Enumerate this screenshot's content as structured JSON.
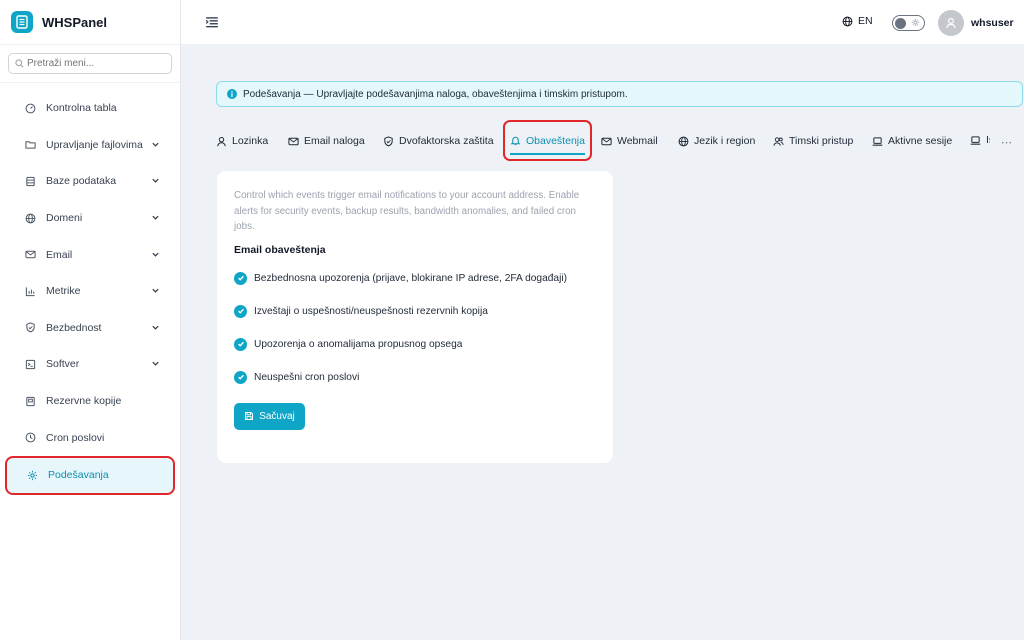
{
  "app": {
    "name": "WHSPanel"
  },
  "search": {
    "placeholder": "Pretraži meni..."
  },
  "sidebar": {
    "items": [
      {
        "label": "Kontrolna tabla",
        "icon": "gauge-icon",
        "expandable": false
      },
      {
        "label": "Upravljanje fajlovima",
        "icon": "folder-icon",
        "expandable": true
      },
      {
        "label": "Baze podataka",
        "icon": "database-icon",
        "expandable": true
      },
      {
        "label": "Domeni",
        "icon": "globe-icon",
        "expandable": true
      },
      {
        "label": "Email",
        "icon": "mail-icon",
        "expandable": true
      },
      {
        "label": "Metrike",
        "icon": "chart-icon",
        "expandable": true
      },
      {
        "label": "Bezbednost",
        "icon": "shield-icon",
        "expandable": true
      },
      {
        "label": "Softver",
        "icon": "terminal-icon",
        "expandable": true
      },
      {
        "label": "Rezervne kopije",
        "icon": "archive-icon",
        "expandable": false
      },
      {
        "label": "Cron poslovi",
        "icon": "clock-icon",
        "expandable": false
      },
      {
        "label": "Podešavanja",
        "icon": "gear-icon",
        "expandable": false,
        "active": true
      }
    ]
  },
  "header": {
    "language": "EN",
    "username": "whsuser"
  },
  "banner": {
    "text": "Podešavanja — Upravljajte podešavanjima naloga, obaveštenjima i timskim pristupom."
  },
  "tabs": [
    {
      "label": "Lozinka",
      "icon": "user-icon"
    },
    {
      "label": "Email naloga",
      "icon": "mail-icon"
    },
    {
      "label": "Dvofaktorska zaštita",
      "icon": "shield-icon"
    },
    {
      "label": "Obaveštenja",
      "icon": "bell-icon",
      "active": true
    },
    {
      "label": "Webmail",
      "icon": "mail-icon"
    },
    {
      "label": "Jezik i region",
      "icon": "globe-icon"
    },
    {
      "label": "Timski pristup",
      "icon": "users-icon"
    },
    {
      "label": "Aktivne sesije",
      "icon": "laptop-icon"
    },
    {
      "label": "Is",
      "icon": "laptop-icon"
    }
  ],
  "notifications": {
    "description": "Control which events trigger email notifications to your account address. Enable alerts for security events, backup results, bandwidth anomalies, and failed cron jobs.",
    "section_title": "Email obaveštenja",
    "options": [
      {
        "label": "Bezbednosna upozorenja (prijave, blokirane IP adrese, 2FA događaji)",
        "checked": true
      },
      {
        "label": "Izveštaji o uspešnosti/neuspešnosti rezervnih kopija",
        "checked": true
      },
      {
        "label": "Upozorenja o anomalijama propusnog opsega",
        "checked": true
      },
      {
        "label": "Neuspešni cron poslovi",
        "checked": true
      }
    ],
    "save_label": "Sačuvaj"
  },
  "colors": {
    "accent": "#0ea5c6",
    "highlight": "#e1262b",
    "background": "#eef1f5"
  }
}
